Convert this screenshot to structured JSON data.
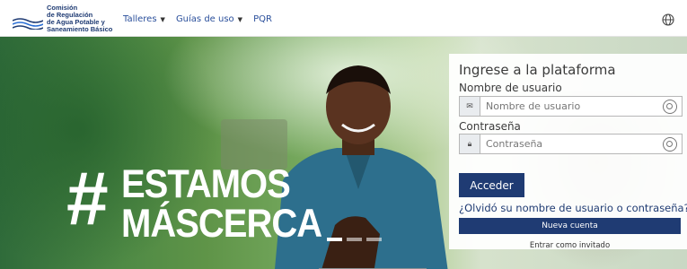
{
  "header": {
    "org_name_lines": [
      "Comisión",
      "de Regulación",
      "de Agua Potable y",
      "Saneamiento Básico"
    ],
    "nav": [
      {
        "label": "Talleres",
        "has_dropdown": true
      },
      {
        "label": "Guías de uso",
        "has_dropdown": true
      },
      {
        "label": "PQR",
        "has_dropdown": false
      }
    ],
    "language_icon": "globe-icon"
  },
  "hero": {
    "slogan_hash": "#",
    "slogan_line1": "ESTAMOS",
    "slogan_line2": "MÁSCERCA",
    "carousel": {
      "count": 3,
      "active": 1
    }
  },
  "login": {
    "title": "Ingrese a la plataforma",
    "username_label": "Nombre de usuario",
    "username_placeholder": "Nombre de usuario",
    "password_label": "Contraseña",
    "password_placeholder": "Contraseña",
    "submit_label": "Acceder",
    "forgot_link": "¿Olvidó su nombre de usuario o contraseña?",
    "new_account_label": "Nueva cuenta",
    "guest_label": "Entrar como invitado"
  },
  "colors": {
    "brand_navy": "#1f3b73",
    "link_blue": "#2a4f9b"
  }
}
